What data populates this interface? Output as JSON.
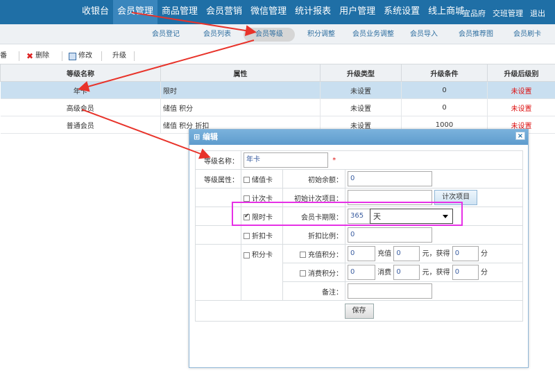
{
  "topnav": {
    "items": [
      "收银台",
      "会员管理",
      "商品管理",
      "会员营销",
      "微信管理",
      "统计报表",
      "用户管理",
      "系统设置",
      "线上商城"
    ],
    "active_index": 1
  },
  "topright": {
    "shop": "宜品府",
    "handover": "交班管理",
    "logout": "退出"
  },
  "subnav": {
    "items": [
      "会员登记",
      "会员列表",
      "会员等级",
      "积分调整",
      "会员业务调整",
      "会员导入",
      "会员推荐图",
      "会员刷卡"
    ],
    "active_index": 2
  },
  "toolbar": {
    "cut": "番",
    "delete": "删除",
    "edit": "修改",
    "upgrade": "升级"
  },
  "grid": {
    "headers": [
      "等级名称",
      "属性",
      "升级类型",
      "升级条件",
      "升级后级别"
    ],
    "rows": [
      {
        "name": "年卡",
        "attr": "限时",
        "type": "未设置",
        "cond": "0",
        "after": "未设置"
      },
      {
        "name": "高级会员",
        "attr": "储值 积分",
        "type": "未设置",
        "cond": "0",
        "after": "未设置"
      },
      {
        "name": "普通会员",
        "attr": "储值 积分 折扣",
        "type": "未设置",
        "cond": "1000",
        "after": "未设置"
      }
    ]
  },
  "dialog": {
    "title": "编辑",
    "close": "×",
    "level_name_label": "等级名称：",
    "level_name_value": "年卡",
    "required_mark": "*",
    "attr_label": "等级属性：",
    "stored_card": "储值卡",
    "initial_balance_label": "初始余额：",
    "initial_balance_value": "0",
    "count_card": "计次卡",
    "count_items_label": "初始计次项目：",
    "count_items_value": "",
    "count_items_button": "计次项目",
    "time_card": "限时卡",
    "validity_label": "会员卡期限：",
    "validity_value": "365",
    "validity_unit": "天",
    "discount_card": "折扣卡",
    "discount_label": "折扣比例：",
    "discount_value": "0",
    "points_card": "积分卡",
    "recharge_points_label": "充值积分：",
    "recharge_points_value": "0",
    "recharge_text": "充值",
    "recharge_amount": "0",
    "recharge_gain_text": "元，获得",
    "recharge_gain_value": "0",
    "points_unit": "分",
    "consume_points_label": "消费积分：",
    "consume_points_value": "0",
    "consume_text": "消费",
    "consume_amount": "0",
    "consume_gain_text": "元，获得",
    "consume_gain_value": "0",
    "remark_label": "备注：",
    "remark_value": "",
    "save_button": "保存"
  },
  "colors": {
    "topbar": "#1f6fa6",
    "highlight_box": "#e630e6",
    "arrow": "#e8332a",
    "not_set": "#dd1111"
  }
}
